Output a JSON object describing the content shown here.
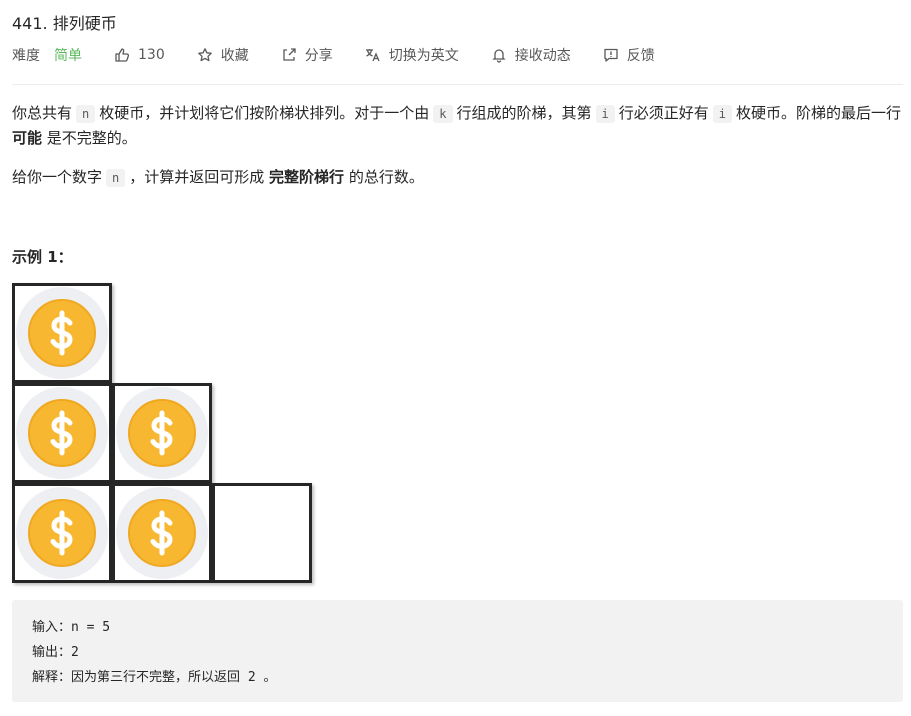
{
  "problem": {
    "title": "441. 排列硬币",
    "difficulty_label": "难度",
    "difficulty_value": "简单",
    "likes": "130",
    "favorite_label": "收藏",
    "share_label": "分享",
    "switch_lang_label": "切换为英文",
    "notify_label": "接收动态",
    "feedback_label": "反馈"
  },
  "description": {
    "p1_part1": "你总共有",
    "var_n": "n",
    "p1_part2": "枚硬币，并计划将它们按阶梯状排列。对于一个由",
    "var_k": "k",
    "p1_part3": "行组成的阶梯，其第",
    "var_i": "i",
    "p1_part4": "行必须正好有",
    "var_i2": "i",
    "p1_part5": "枚硬币。阶梯的最后一行",
    "p1_bold": "可能",
    "p1_part6": "是不完整的。",
    "p2_part1": "给你一个数字",
    "var_n2": "n",
    "p2_part2": "，计算并返回可形成",
    "p2_bold": "完整阶梯行",
    "p2_part3": "的总行数。"
  },
  "example": {
    "title": "示例 1：",
    "input": "输入：n = 5",
    "output": "输出：2",
    "explanation": "解释：因为第三行不完整，所以返回 2 。"
  },
  "colors": {
    "difficulty_easy": "#5cb85c",
    "coin": "#f7b731"
  }
}
